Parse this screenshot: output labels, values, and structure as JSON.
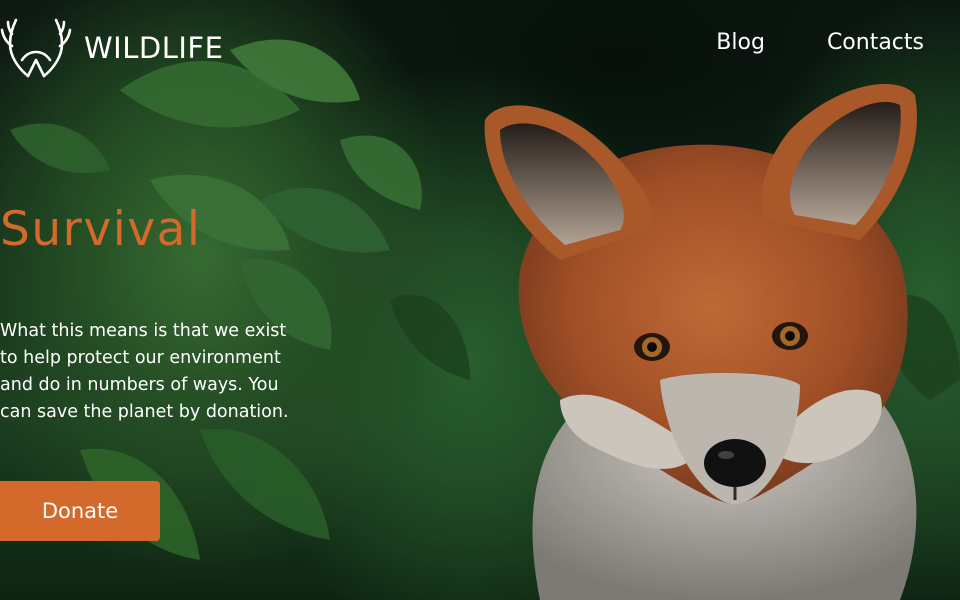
{
  "brand": {
    "name": "WILDLIFE",
    "logo_icon": "antlers-icon"
  },
  "nav": {
    "items": [
      {
        "label": "Blog"
      },
      {
        "label": "Contacts"
      }
    ]
  },
  "hero": {
    "headline": "Survival",
    "body": "What this means is that we exist to help protect our environment and do in numbers of ways. You can save the planet by donation.",
    "cta_label": "Donate",
    "image": "fox-in-foliage-photo"
  },
  "colors": {
    "accent": "#d4692c",
    "text": "#ffffff",
    "foliage": "#2f6b34"
  }
}
